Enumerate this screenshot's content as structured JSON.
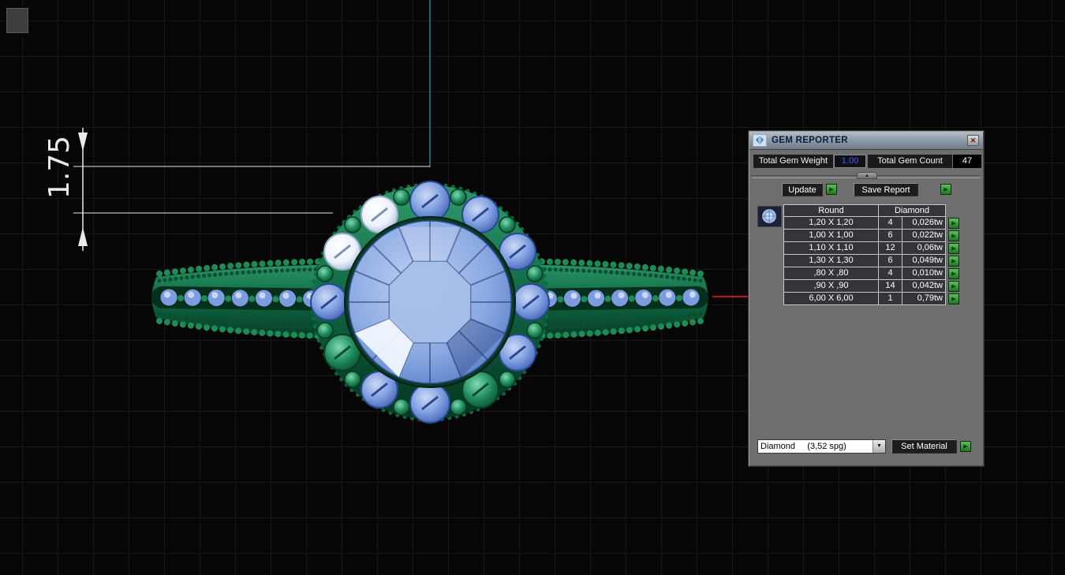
{
  "viewport": {
    "dimension_label": "1.75"
  },
  "panel": {
    "title": "GEM REPORTER",
    "close_glyph": "✕",
    "divider_glyph": "▲",
    "stats": {
      "weight_label": "Total Gem Weight",
      "weight_value": "1.00",
      "count_label": "Total Gem Count",
      "count_value": "47"
    },
    "actions": {
      "update_label": "Update",
      "save_report_label": "Save Report",
      "set_material_label": "Set Material",
      "run_icon": "▶"
    },
    "table": {
      "col_round": "Round",
      "col_diamond": "Diamond",
      "rows": [
        {
          "size": "1,20 X 1,20",
          "count": "4",
          "weight": "0,026tw"
        },
        {
          "size": "1,00 X 1,00",
          "count": "6",
          "weight": "0,022tw"
        },
        {
          "size": "1,10 X 1,10",
          "count": "12",
          "weight": "0,06tw"
        },
        {
          "size": "1,30 X 1,30",
          "count": "6",
          "weight": "0,049tw"
        },
        {
          "size": ",80 X ,80",
          "count": "4",
          "weight": "0,010tw"
        },
        {
          "size": ",90 X ,90",
          "count": "14",
          "weight": "0,042tw"
        },
        {
          "size": "6,00 X 6,00",
          "count": "1",
          "weight": "0,79tw"
        }
      ]
    },
    "material": {
      "dropdown_value": "Diamond     (3,52 spg)",
      "dropdown_arrow": "▼"
    }
  },
  "colors": {
    "accent_green_button": "#2d8c2d",
    "weight_value_blue": "#4b5cf0",
    "metal_green": "#0e5c3e",
    "gem_blue": "#5b82cc",
    "axis_teal": "#2f8091",
    "axis_red": "#c21414"
  }
}
